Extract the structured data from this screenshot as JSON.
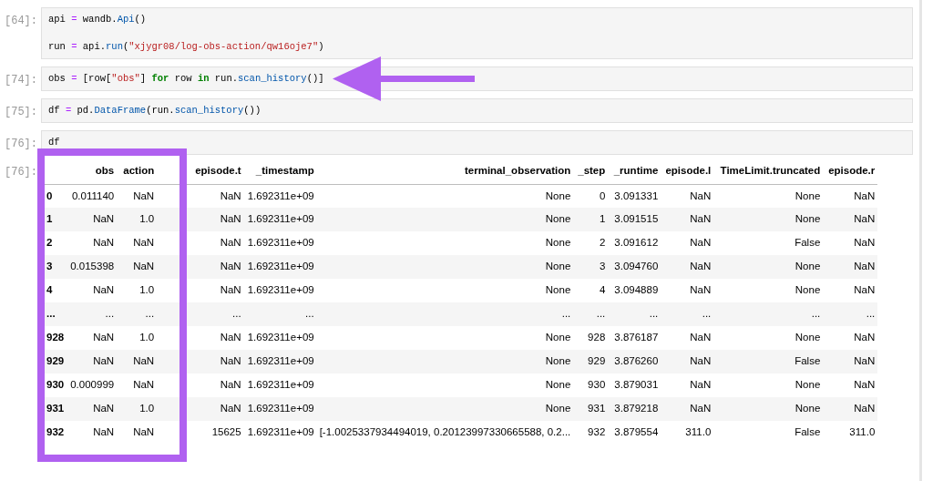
{
  "cells": [
    {
      "prompt": "[64]:",
      "lines": [
        {
          "kind": "code",
          "tokens": [
            {
              "kind": "name",
              "text": "api"
            },
            {
              "kind": "op",
              "text": " = "
            },
            {
              "kind": "name",
              "text": "wandb."
            },
            {
              "kind": "call",
              "text": "Api"
            },
            {
              "kind": "name",
              "text": "()"
            }
          ]
        },
        {
          "kind": "blank"
        },
        {
          "kind": "code",
          "tokens": [
            {
              "kind": "name",
              "text": "run"
            },
            {
              "kind": "op",
              "text": " = "
            },
            {
              "kind": "name",
              "text": "api."
            },
            {
              "kind": "call",
              "text": "run"
            },
            {
              "kind": "name",
              "text": "("
            },
            {
              "kind": "str",
              "text": "\"xjygr08/log-obs-action/qw16oje7\""
            },
            {
              "kind": "name",
              "text": ")"
            }
          ]
        }
      ]
    },
    {
      "prompt": "[74]:",
      "lines": [
        {
          "kind": "code",
          "tokens": [
            {
              "kind": "name",
              "text": "obs"
            },
            {
              "kind": "op",
              "text": " = "
            },
            {
              "kind": "name",
              "text": "[row["
            },
            {
              "kind": "str",
              "text": "\"obs\""
            },
            {
              "kind": "name",
              "text": "] "
            },
            {
              "kind": "kw",
              "text": "for"
            },
            {
              "kind": "name",
              "text": " row "
            },
            {
              "kind": "kw",
              "text": "in"
            },
            {
              "kind": "name",
              "text": " run."
            },
            {
              "kind": "call",
              "text": "scan_history"
            },
            {
              "kind": "name",
              "text": "()]"
            }
          ]
        }
      ]
    },
    {
      "prompt": "[75]:",
      "lines": [
        {
          "kind": "code",
          "tokens": [
            {
              "kind": "name",
              "text": "df"
            },
            {
              "kind": "op",
              "text": " = "
            },
            {
              "kind": "name",
              "text": "pd."
            },
            {
              "kind": "call",
              "text": "DataFrame"
            },
            {
              "kind": "name",
              "text": "(run."
            },
            {
              "kind": "call",
              "text": "scan_history"
            },
            {
              "kind": "name",
              "text": "())"
            }
          ]
        }
      ]
    },
    {
      "prompt": "[76]:",
      "lines": [
        {
          "kind": "code",
          "tokens": [
            {
              "kind": "name",
              "text": "df"
            }
          ]
        }
      ]
    }
  ],
  "output": {
    "prompt": "[76]:",
    "table": {
      "columns": [
        "obs",
        "action",
        "episode.t",
        "_timestamp",
        "terminal_observation",
        "_step",
        "_runtime",
        "episode.l",
        "TimeLimit.truncated",
        "episode.r"
      ],
      "rows": [
        {
          "index": "0",
          "cells": [
            "0.011140",
            "NaN",
            "NaN",
            "1.692311e+09",
            "None",
            "0",
            "3.091331",
            "NaN",
            "None",
            "NaN"
          ]
        },
        {
          "index": "1",
          "cells": [
            "NaN",
            "1.0",
            "NaN",
            "1.692311e+09",
            "None",
            "1",
            "3.091515",
            "NaN",
            "None",
            "NaN"
          ]
        },
        {
          "index": "2",
          "cells": [
            "NaN",
            "NaN",
            "NaN",
            "1.692311e+09",
            "None",
            "2",
            "3.091612",
            "NaN",
            "False",
            "NaN"
          ]
        },
        {
          "index": "3",
          "cells": [
            "0.015398",
            "NaN",
            "NaN",
            "1.692311e+09",
            "None",
            "3",
            "3.094760",
            "NaN",
            "None",
            "NaN"
          ]
        },
        {
          "index": "4",
          "cells": [
            "NaN",
            "1.0",
            "NaN",
            "1.692311e+09",
            "None",
            "4",
            "3.094889",
            "NaN",
            "None",
            "NaN"
          ]
        },
        {
          "index": "...",
          "cells": [
            "...",
            "...",
            "...",
            "...",
            "...",
            "...",
            "...",
            "...",
            "...",
            "..."
          ]
        },
        {
          "index": "928",
          "cells": [
            "NaN",
            "1.0",
            "NaN",
            "1.692311e+09",
            "None",
            "928",
            "3.876187",
            "NaN",
            "None",
            "NaN"
          ]
        },
        {
          "index": "929",
          "cells": [
            "NaN",
            "NaN",
            "NaN",
            "1.692311e+09",
            "None",
            "929",
            "3.876260",
            "NaN",
            "False",
            "NaN"
          ]
        },
        {
          "index": "930",
          "cells": [
            "0.000999",
            "NaN",
            "NaN",
            "1.692311e+09",
            "None",
            "930",
            "3.879031",
            "NaN",
            "None",
            "NaN"
          ]
        },
        {
          "index": "931",
          "cells": [
            "NaN",
            "1.0",
            "NaN",
            "1.692311e+09",
            "None",
            "931",
            "3.879218",
            "NaN",
            "None",
            "NaN"
          ]
        },
        {
          "index": "932",
          "cells": [
            "NaN",
            "NaN",
            "15625",
            "1.692311e+09",
            "[-1.0025337934494019, 0.20123997330665588, 0.2...",
            "932",
            "3.879554",
            "311.0",
            "False",
            "311.0"
          ]
        }
      ]
    }
  }
}
